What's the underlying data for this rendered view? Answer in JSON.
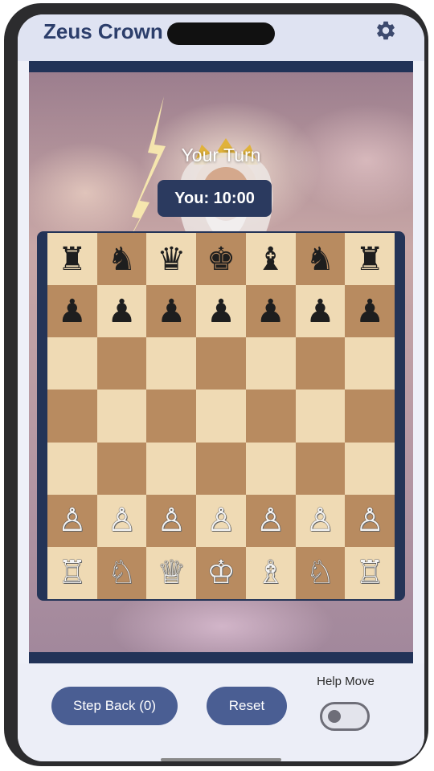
{
  "app": {
    "title": "Zeus Crown Ch",
    "settings_icon": "gear-icon"
  },
  "game": {
    "turn_label": "Your Turn",
    "timer": "You: 10:00",
    "background": "zeus-illustration"
  },
  "board": {
    "rows": [
      [
        "♜",
        "♞",
        "♛",
        "♚",
        "♝",
        "♞",
        "♜"
      ],
      [
        "♟",
        "♟",
        "♟",
        "♟",
        "♟",
        "♟",
        "♟"
      ],
      [
        "",
        "",
        "",
        "",
        "",
        "",
        ""
      ],
      [
        "",
        "",
        "",
        "",
        "",
        "",
        ""
      ],
      [
        "",
        "",
        "",
        "",
        "",
        "",
        ""
      ],
      [
        "♙",
        "♙",
        "♙",
        "♙",
        "♙",
        "♙",
        "♙"
      ],
      [
        "♖",
        "♘",
        "♕",
        "♔",
        "♗",
        "♘",
        "♖"
      ]
    ],
    "colors": {
      "light": "#efdab4",
      "dark": "#b88b60",
      "frame": "#243457"
    }
  },
  "controls": {
    "step_back_label": "Step Back (0)",
    "reset_label": "Reset",
    "help_move_label": "Help Move",
    "help_move_enabled": false
  },
  "theme": {
    "accent": "#4a5e93",
    "title": "#2c3e6b"
  }
}
